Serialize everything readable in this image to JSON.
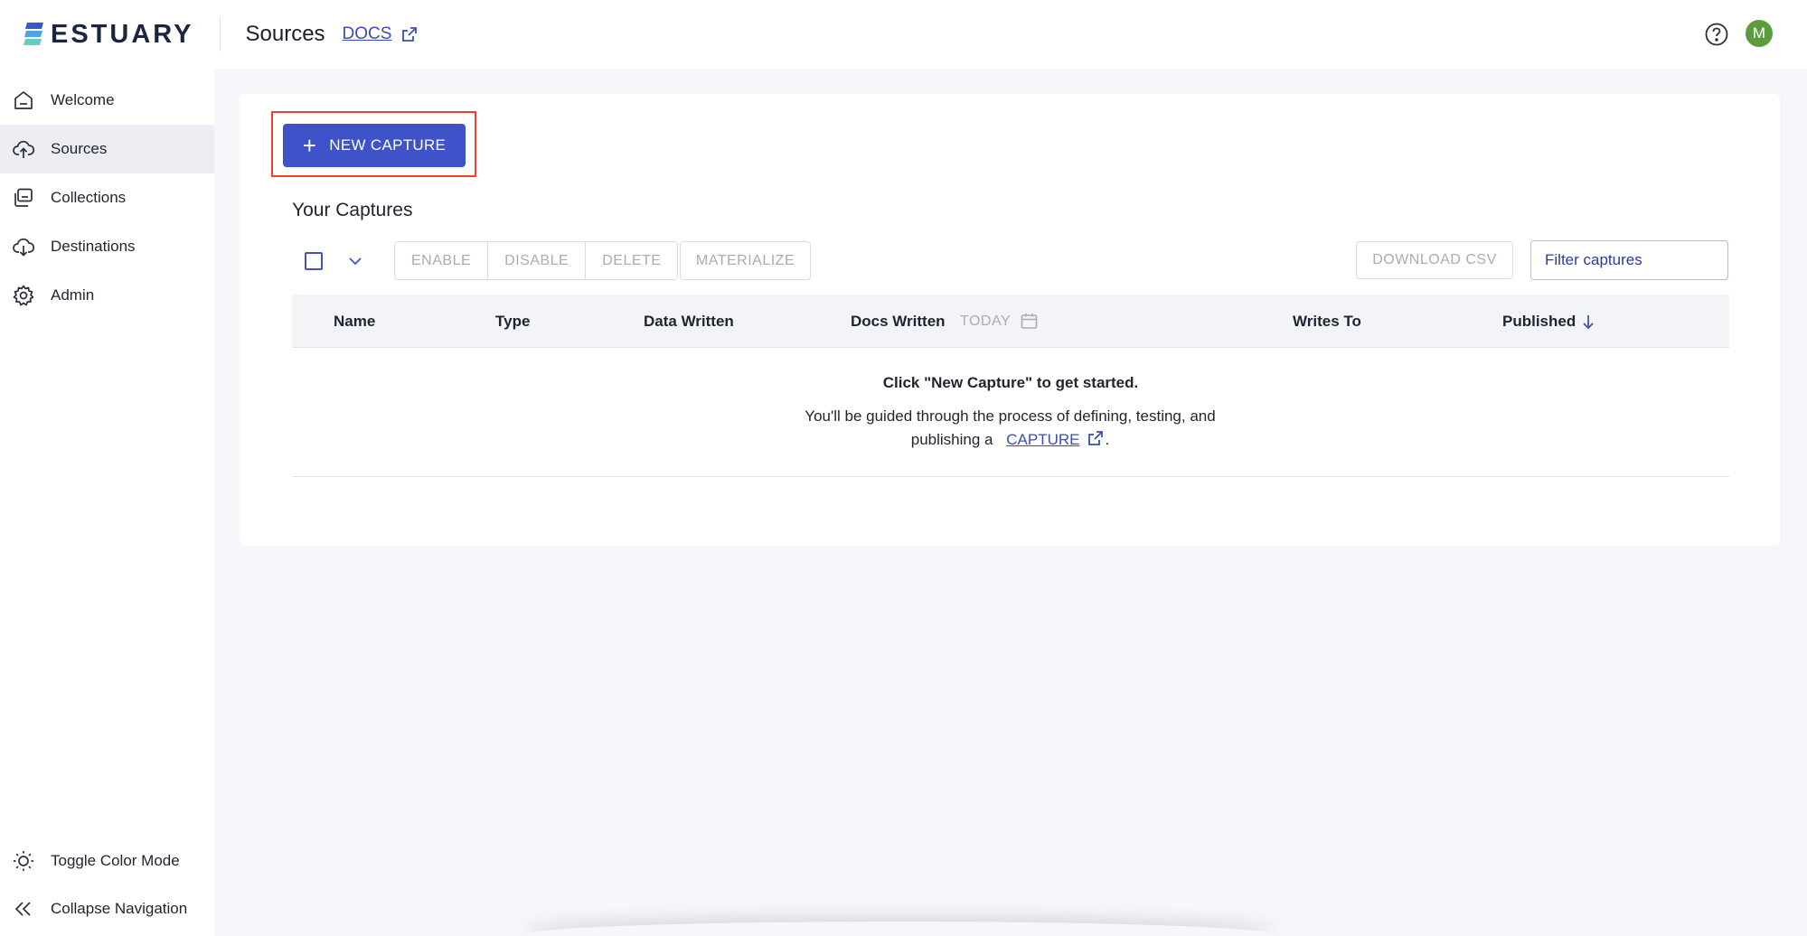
{
  "brand": {
    "name": "ESTUARY"
  },
  "header": {
    "title": "Sources",
    "docs_label": "docs",
    "avatar_initial": "M"
  },
  "sidebar": {
    "items": [
      {
        "label": "Welcome",
        "icon": "home-icon"
      },
      {
        "label": "Sources",
        "icon": "cloud-upload-icon",
        "active": true
      },
      {
        "label": "Collections",
        "icon": "collections-icon"
      },
      {
        "label": "Destinations",
        "icon": "cloud-download-icon"
      },
      {
        "label": "Admin",
        "icon": "gear-icon"
      }
    ],
    "footer": [
      {
        "label": "Toggle Color Mode",
        "icon": "sun-icon"
      },
      {
        "label": "Collapse Navigation",
        "icon": "double-chevron-left-icon"
      }
    ]
  },
  "main": {
    "new_capture_label": "NEW CAPTURE",
    "section_title": "Your Captures",
    "actions": [
      "ENABLE",
      "DISABLE",
      "DELETE"
    ],
    "materialize_label": "MATERIALIZE",
    "download_csv_label": "DOWNLOAD CSV",
    "filter_placeholder": "Filter captures",
    "table": {
      "columns": [
        "Name",
        "Type",
        "Data Written",
        "Docs Written",
        "Writes To",
        "Published"
      ],
      "range_label": "TODAY",
      "empty_title": "Click \"New Capture\" to get started.",
      "empty_desc_line1": "You'll be guided through the process of defining, testing, and",
      "empty_desc_prefix": "publishing a",
      "empty_desc_link": "CAPTURE",
      "empty_desc_suffix": "."
    }
  },
  "colors": {
    "accent": "#3e52c9",
    "highlight": "#e8432d",
    "avatar": "#5b9c3e"
  }
}
